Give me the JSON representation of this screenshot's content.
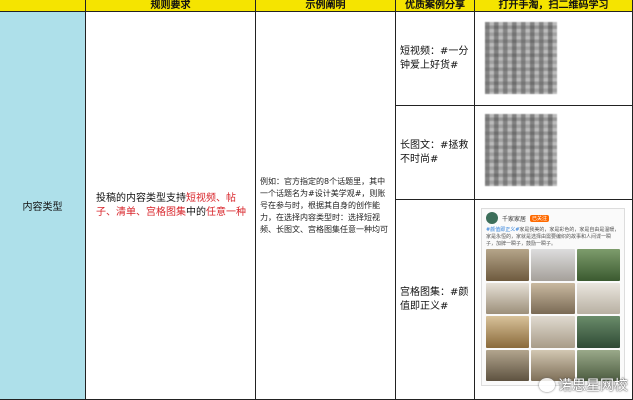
{
  "headers": [
    "规则要求",
    "示例阐明",
    "优质案例分享",
    "打开手淘，扫二维码学习"
  ],
  "row_label": "内容类型",
  "rule": {
    "prefix": "投稿的内容类型支持",
    "type1": "短视频",
    "sep1": "、",
    "type2": "帖子",
    "sep2": "、",
    "type3": "清单",
    "sep3": "、",
    "type4": "宫格图集",
    "mid": "中的",
    "any": "任意一种"
  },
  "example": "例如：官方指定的8个话题里，其中一个话题名为#设计美学观#，则账号在参与时，根据其自身的创作能力，在选择内容类型时：选择短视频、长图文、宫格图集任意一种均可",
  "cases": [
    {
      "label": "短视频：#一分钟爱上好货#"
    },
    {
      "label": "长图文：#拯救不时尚#"
    },
    {
      "label": "宫格图集：#颜值即正义#"
    }
  ],
  "post": {
    "author": "千家家居",
    "tag": "已关注",
    "text_tag": "#颜值即正义#",
    "text": "家是我美的，家是彩色的，家是自由是温暖，家是永恒的，家就是选择由需要编织的故事和人间谍一瞬子，加牌一瞬子，鼓励一瞬子。"
  },
  "watermark": "诺思星网校",
  "colors": {
    "header": "#f5e400",
    "label_bg": "#aee0ea",
    "highlight": "#d8242a"
  }
}
